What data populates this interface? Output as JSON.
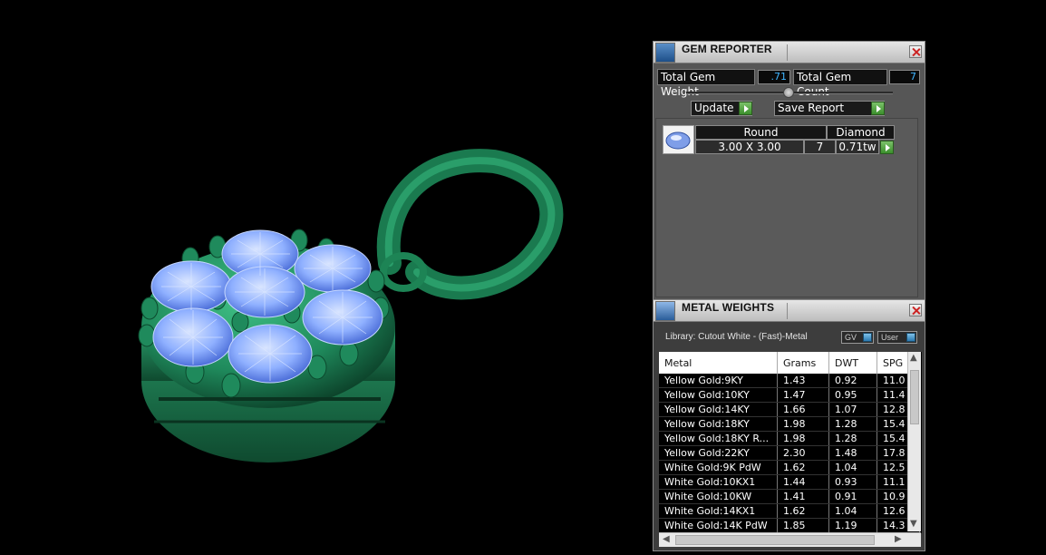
{
  "gem_reporter": {
    "title": "GEM REPORTER",
    "total_weight_label": "Total Gem Weight",
    "total_weight_value": ".71",
    "total_count_label": "Total Gem Count",
    "total_count_value": "7",
    "update_label": "Update",
    "save_label": "Save Report",
    "gem": {
      "shape": "Round",
      "type": "Diamond",
      "size": "3.00 X 3.00",
      "count": "7",
      "weight": "0.71tw"
    }
  },
  "metal_weights": {
    "title": "METAL WEIGHTS",
    "library": "Library: Cutout White - (Fast)-Metal",
    "gv_label": "GV",
    "user_label": "User",
    "columns": [
      "Metal",
      "Grams",
      "DWT",
      "SPG"
    ],
    "rows": [
      [
        "Yellow Gold:9KY",
        "1.43",
        "0.92",
        "11.0"
      ],
      [
        "Yellow Gold:10KY",
        "1.47",
        "0.95",
        "11.4"
      ],
      [
        "Yellow Gold:14KY",
        "1.66",
        "1.07",
        "12.8"
      ],
      [
        "Yellow Gold:18KY",
        "1.98",
        "1.28",
        "15.4"
      ],
      [
        "Yellow Gold:18KY R...",
        "1.98",
        "1.28",
        "15.4"
      ],
      [
        "Yellow Gold:22KY",
        "2.30",
        "1.48",
        "17.8"
      ],
      [
        "White Gold:9K PdW",
        "1.62",
        "1.04",
        "12.5"
      ],
      [
        "White Gold:10KX1",
        "1.44",
        "0.93",
        "11.1"
      ],
      [
        "White Gold:10KW",
        "1.41",
        "0.91",
        "10.9"
      ],
      [
        "White Gold:14KX1",
        "1.62",
        "1.04",
        "12.6"
      ],
      [
        "White Gold:14K PdW",
        "1.85",
        "1.19",
        "14.3"
      ]
    ]
  },
  "colors": {
    "metal_green": "#1f8a5c",
    "gem_blue": "#7fa8ff",
    "accent_value": "#3fb5ff"
  }
}
